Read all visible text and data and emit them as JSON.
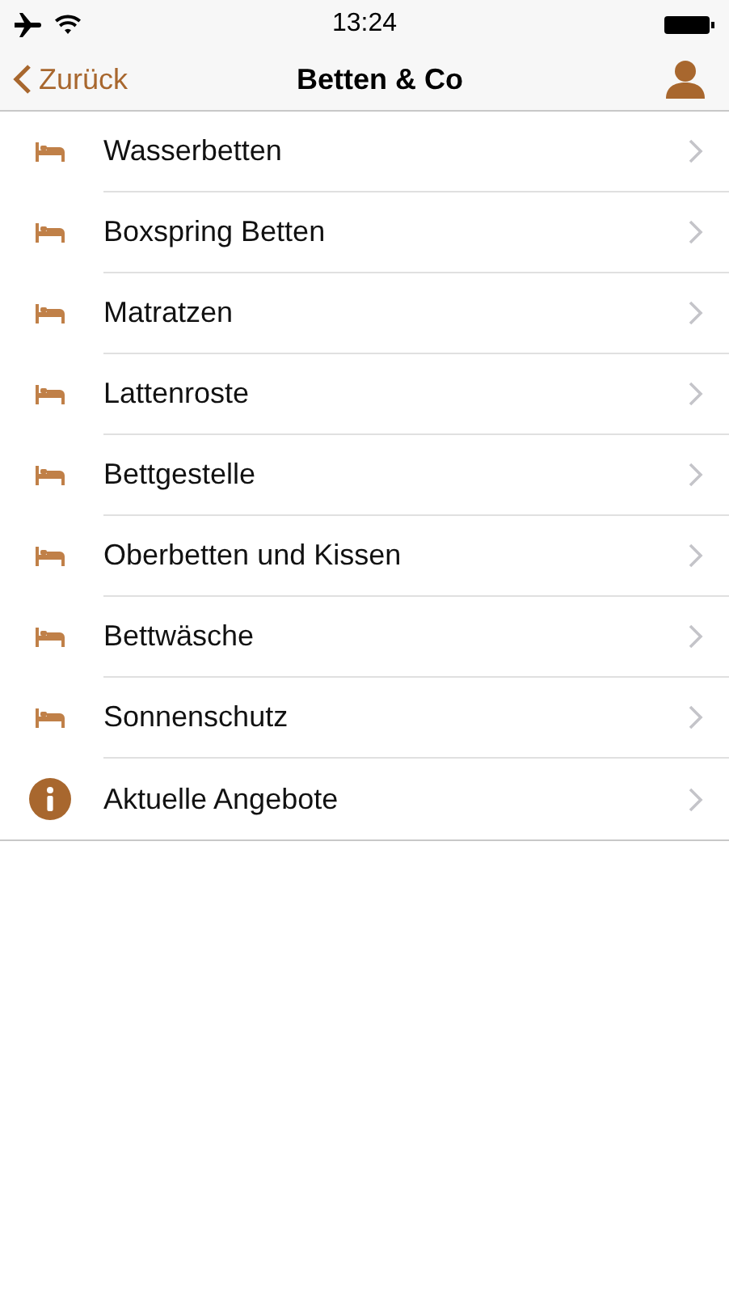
{
  "status_bar": {
    "time": "13:24"
  },
  "nav": {
    "back": "Zurück",
    "title": "Betten & Co"
  },
  "items": [
    {
      "label": "Wasserbetten",
      "kind": "bed"
    },
    {
      "label": "Boxspring Betten",
      "kind": "bed"
    },
    {
      "label": "Matratzen",
      "kind": "bed"
    },
    {
      "label": "Lattenroste",
      "kind": "bed"
    },
    {
      "label": "Bettgestelle",
      "kind": "bed"
    },
    {
      "label": "Oberbetten und Kissen",
      "kind": "bed"
    },
    {
      "label": "Bettwäsche",
      "kind": "bed"
    },
    {
      "label": "Sonnenschutz",
      "kind": "bed"
    },
    {
      "label": "Aktuelle Angebote",
      "kind": "info"
    }
  ]
}
